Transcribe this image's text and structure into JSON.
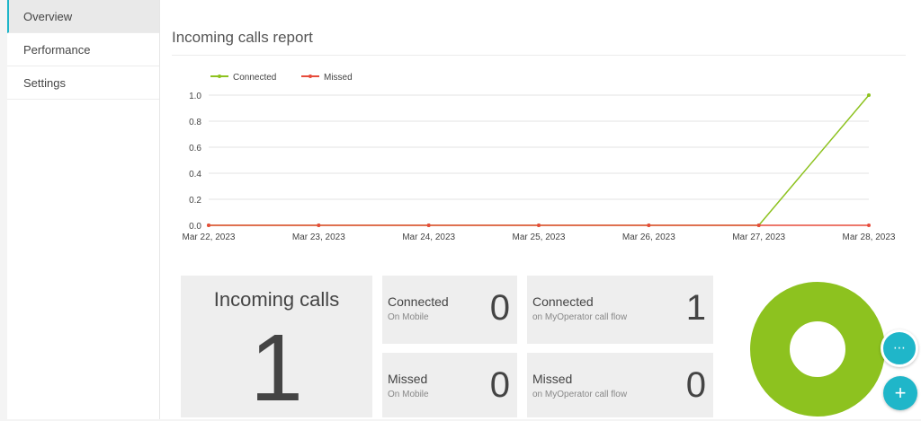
{
  "sidebar": {
    "items": [
      {
        "label": "Overview",
        "active": true
      },
      {
        "label": "Performance",
        "active": false
      },
      {
        "label": "Settings",
        "active": false
      }
    ]
  },
  "report": {
    "title": "Incoming calls report"
  },
  "chart_data": {
    "type": "line",
    "x": [
      "Mar 22, 2023",
      "Mar 23, 2023",
      "Mar 24, 2023",
      "Mar 25, 2023",
      "Mar 26, 2023",
      "Mar 27, 2023",
      "Mar 28, 2023"
    ],
    "series": [
      {
        "name": "Connected",
        "color": "#8dc21f",
        "values": [
          0,
          0,
          0,
          0,
          0,
          0,
          1
        ]
      },
      {
        "name": "Missed",
        "color": "#e74c3c",
        "values": [
          0,
          0,
          0,
          0,
          0,
          0,
          0
        ]
      }
    ],
    "yticks": [
      "0.0",
      "0.2",
      "0.4",
      "0.6",
      "0.8",
      "1.0"
    ],
    "ylim": [
      0,
      1
    ],
    "grid": true,
    "legend": "top-left"
  },
  "tiles": {
    "incoming": {
      "label": "Incoming calls",
      "value": "1"
    },
    "connected_mobile": {
      "label": "Connected",
      "sub": "On Mobile",
      "value": "0"
    },
    "connected_flow": {
      "label": "Connected",
      "sub": "on MyOperator call flow",
      "value": "1"
    },
    "missed_mobile": {
      "label": "Missed",
      "sub": "On Mobile",
      "value": "0"
    },
    "missed_flow": {
      "label": "Missed",
      "sub": "on MyOperator call flow",
      "value": "0"
    }
  },
  "donut": {
    "color": "#8dc21f",
    "segments": [
      {
        "share": 1.0,
        "color": "#8dc21f"
      }
    ]
  },
  "fabs": {
    "chat_glyph": "⋯",
    "add_glyph": "+"
  }
}
